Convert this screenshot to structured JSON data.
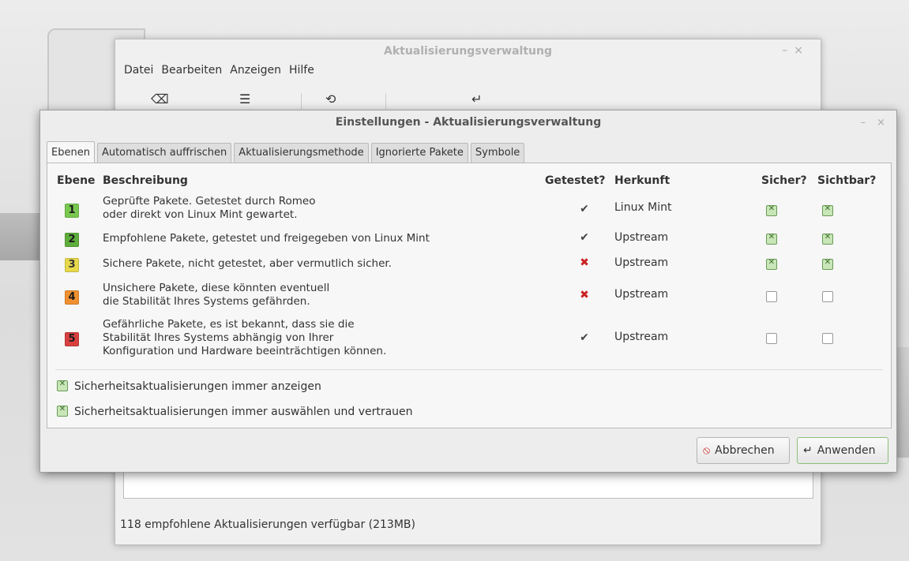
{
  "background_window": {
    "title": "Aktualisierungsverwaltung",
    "controls": [
      "–",
      "×"
    ],
    "menu": [
      "Datei",
      "Bearbeiten",
      "Anzeigen",
      "Hilfe"
    ],
    "toolbar_icons": [
      "clear-icon",
      "select-all-icon",
      "refresh-icon",
      "install-icon"
    ],
    "toolbar_glyphs": [
      "⌫",
      "☰",
      "⟲",
      "↵"
    ],
    "status": "118 empfohlene Aktualisierungen verfügbar (213MB)"
  },
  "dialog": {
    "title": "Einstellungen - Aktualisierungsverwaltung",
    "controls": {
      "minimize": "–",
      "close": "×"
    },
    "tabs": [
      "Ebenen",
      "Automatisch auffrischen",
      "Aktualisierungsmethode",
      "Ignorierte Pakete",
      "Symbole"
    ],
    "active_tab": "Ebenen",
    "headers": {
      "level": "Ebene",
      "description": "Beschreibung",
      "tested": "Getestet?",
      "origin": "Herkunft",
      "safe": "Sicher?",
      "visible": "Sichtbar?"
    },
    "levels": [
      {
        "num": "1",
        "color": "#78c850",
        "lines": [
          "Geprüfte Pakete. Getestet durch Romeo",
          "oder direkt von Linux Mint gewartet."
        ],
        "tested": true,
        "tested_glyph": "✔",
        "origin": "Linux Mint",
        "safe": true,
        "visible": true
      },
      {
        "num": "2",
        "color": "#5eae3c",
        "lines": [
          "Empfohlene Pakete, getestet und freigegeben von Linux Mint"
        ],
        "tested": true,
        "tested_glyph": "✔",
        "origin": "Upstream",
        "safe": true,
        "visible": true
      },
      {
        "num": "3",
        "color": "#e6d84a",
        "lines": [
          "Sichere Pakete, nicht getestet, aber vermutlich sicher."
        ],
        "tested": false,
        "tested_glyph": "✖",
        "origin": "Upstream",
        "safe": true,
        "visible": true
      },
      {
        "num": "4",
        "color": "#f09030",
        "lines": [
          "Unsichere Pakete, diese könnten eventuell",
          "die Stabilität Ihres Systems gefährden."
        ],
        "tested": false,
        "tested_glyph": "✖",
        "origin": "Upstream",
        "safe": false,
        "visible": false
      },
      {
        "num": "5",
        "color": "#d84040",
        "lines": [
          "Gefährliche Pakete, es ist bekannt, dass sie die",
          "Stabilität Ihres Systems abhängig von Ihrer",
          "Konfiguration und Hardware beeinträchtigen können."
        ],
        "tested": true,
        "tested_glyph": "✔",
        "origin": "Upstream",
        "safe": false,
        "visible": false
      }
    ],
    "options": [
      {
        "label": "Sicherheitsaktualisierungen immer anzeigen",
        "checked": true
      },
      {
        "label": "Sicherheitsaktualisierungen immer auswählen und vertrauen",
        "checked": true
      }
    ],
    "buttons": {
      "cancel": "Abbrechen",
      "cancel_icon": "⦸",
      "apply": "Anwenden",
      "apply_icon": "↵"
    }
  }
}
